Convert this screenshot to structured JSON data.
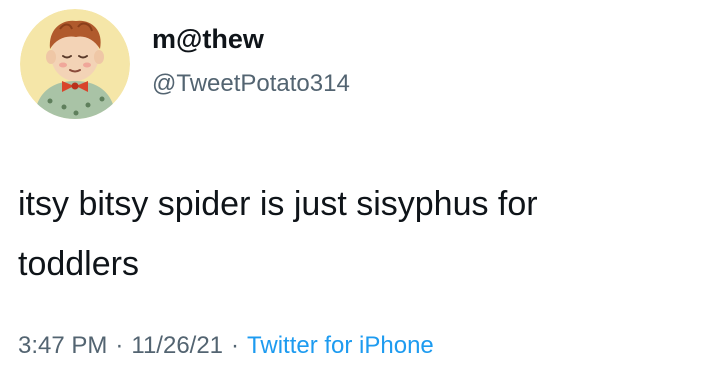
{
  "author": {
    "display_name": "m@thew",
    "handle": "@TweetPotato314",
    "avatar_icon": "cartoon-child-avatar-icon"
  },
  "tweet": {
    "text_line_1": "itsy bitsy spider is just sisyphus for",
    "text_line_2": "toddlers"
  },
  "meta": {
    "time": "3:47 PM",
    "separator": "·",
    "date": "11/26/21",
    "source": "Twitter for iPhone"
  },
  "colors": {
    "text_primary": "#0f1419",
    "text_secondary": "#536471",
    "link": "#1d9bf0",
    "avatar_background": "#f5e6a8"
  }
}
